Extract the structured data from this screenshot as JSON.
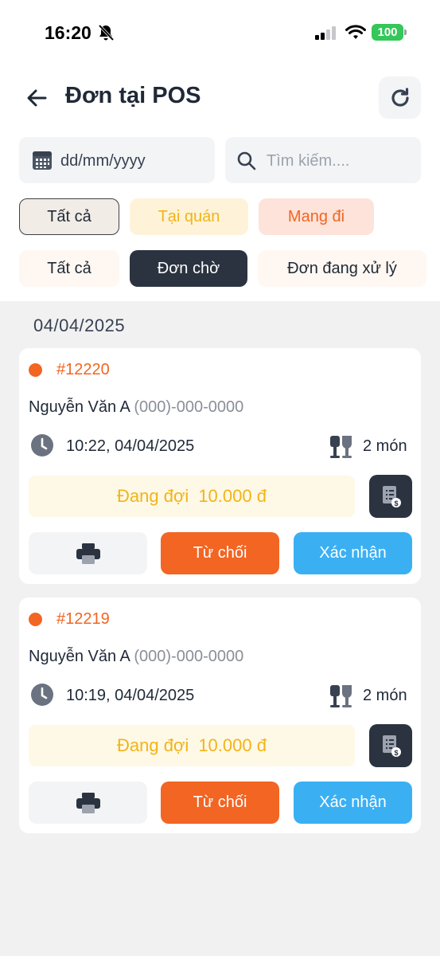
{
  "status_bar": {
    "time": "16:20",
    "battery": "100"
  },
  "header": {
    "title": "Đơn tại POS"
  },
  "filters": {
    "date_placeholder": "dd/mm/yyyy",
    "search_placeholder": "Tìm kiếm....",
    "channel_tabs": [
      "Tất cả",
      "Tại quán",
      "Mang đi"
    ],
    "channel_selected": "Tất cả",
    "status_tabs": [
      "Tất cả",
      "Đơn chờ",
      "Đơn đang xử lý"
    ],
    "status_selected": "Đơn chờ"
  },
  "group_date": "04/04/2025",
  "orders": [
    {
      "id": "#12220",
      "customer": "Nguyễn Văn A",
      "phone": "(000)-000-0000",
      "time": "10:22, 04/04/2025",
      "items": "2 món",
      "status": "Đang đợi",
      "amount": "10.000 đ",
      "reject_label": "Từ chối",
      "confirm_label": "Xác nhận"
    },
    {
      "id": "#12219",
      "customer": "Nguyễn Văn A",
      "phone": "(000)-000-0000",
      "time": "10:19, 04/04/2025",
      "items": "2 món",
      "status": "Đang đợi",
      "amount": "10.000 đ",
      "reject_label": "Từ chối",
      "confirm_label": "Xác nhận"
    }
  ],
  "colors": {
    "accent_orange": "#f26522",
    "accent_blue": "#3ab0f3",
    "pending_yellow": "#f2b418",
    "dark": "#2b3340"
  },
  "icons": [
    "bell-slash-icon",
    "signal-icon",
    "wifi-icon",
    "back-arrow-icon",
    "refresh-icon",
    "calendar-icon",
    "search-icon",
    "clock-icon",
    "fork-knife-icon",
    "bill-icon",
    "printer-icon"
  ]
}
